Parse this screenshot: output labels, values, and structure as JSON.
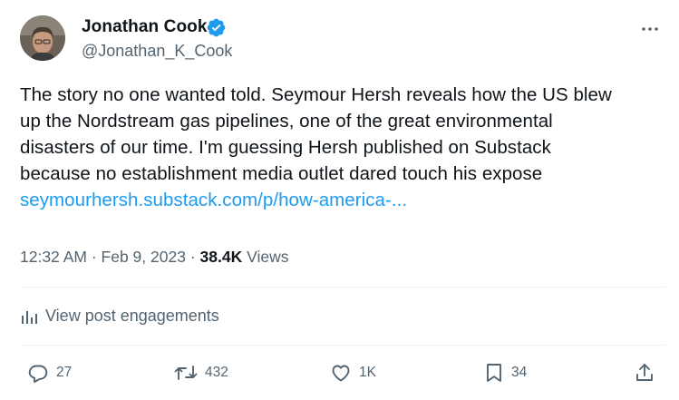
{
  "author": {
    "name": "Jonathan Cook",
    "handle": "@Jonathan_K_Cook",
    "verified": true
  },
  "tweet": {
    "lines": [
      "The story no one wanted told. Seymour Hersh reveals how the US blew",
      "up the Nordstream gas pipelines, one of the great environmental",
      "disasters of our time. I'm guessing Hersh published on Substack",
      "because no establishment media outlet dared touch his expose"
    ],
    "link": "seymourhersh.substack.com/p/how-america-..."
  },
  "meta": {
    "time": "12:32 AM",
    "separator": "·",
    "date": "Feb 9, 2023",
    "views_count": "38.4K",
    "views_label": "Views"
  },
  "engagements_label": "View post engagements",
  "actions": {
    "replies": "27",
    "reposts": "432",
    "likes": "1K",
    "bookmarks": "34"
  },
  "colors": {
    "link": "#1d9bf0",
    "verified": "#1d9bf0",
    "secondary_text": "#536471",
    "primary_text": "#0f1419",
    "divider": "#eff3f4"
  },
  "icons": [
    "verified-badge-icon",
    "more-icon",
    "analytics-icon",
    "reply-icon",
    "repost-icon",
    "like-icon",
    "bookmark-icon",
    "share-icon"
  ]
}
